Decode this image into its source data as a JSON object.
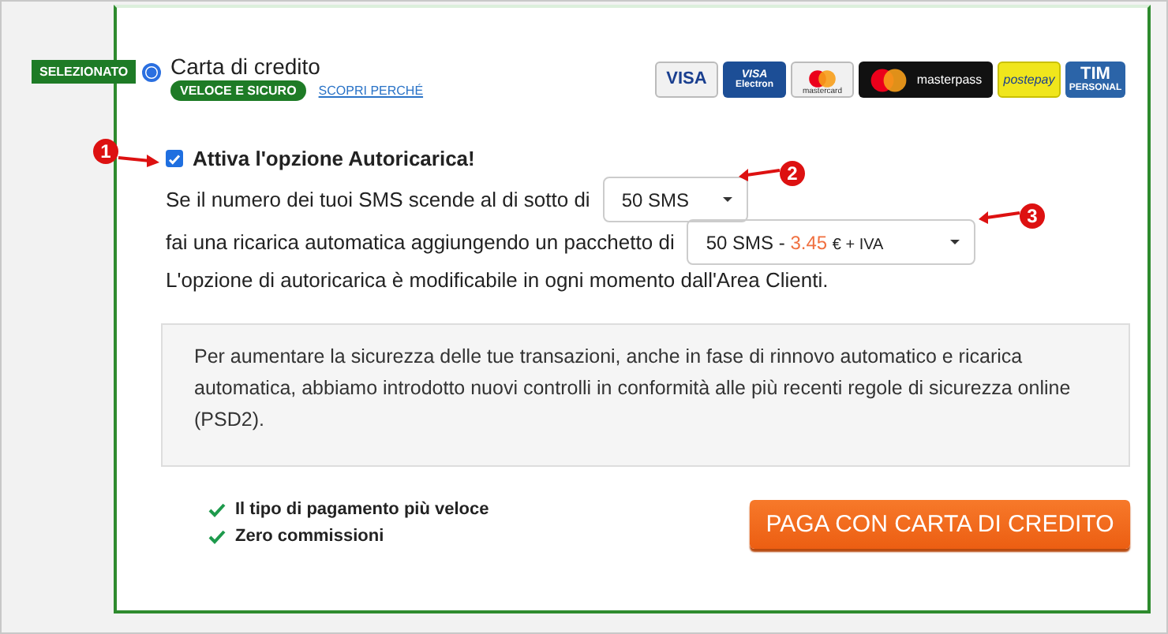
{
  "method": {
    "badge": "SELEZIONATO",
    "selected": true,
    "title": "Carta di credito",
    "tag": "VELOCE E SICURO",
    "link": "SCOPRI PERCHÉ"
  },
  "cards": [
    {
      "kind": "visa",
      "label": "VISA"
    },
    {
      "kind": "electron",
      "label": "VISA",
      "sub": "Electron"
    },
    {
      "kind": "mastercard",
      "label": "mastercard"
    },
    {
      "kind": "masterpass",
      "label": "masterpass"
    },
    {
      "kind": "postepay",
      "label": "postepay"
    },
    {
      "kind": "tim",
      "label": "TIM",
      "sub": "PERSONAL"
    }
  ],
  "autorecharge": {
    "label": "Attiva l'opzione Autoricarica!",
    "checked": true,
    "callout": "1"
  },
  "threshold": {
    "text": "Se il numero dei tuoi SMS scende al di sotto di",
    "value": "50 SMS",
    "callout": "2"
  },
  "package": {
    "text": "fai una ricarica automatica aggiungendo un pacchetto di",
    "value": "50 SMS -",
    "price": "3.45",
    "suffix": "€ + IVA",
    "callout": "3"
  },
  "note": "L'opzione di autoricarica è modificabile in ogni momento dall'Area Clienti.",
  "info": "Per aumentare la sicurezza delle tue transazioni, anche in fase di rinnovo automatico e ricarica automatica, abbiamo introdotto nuovi controlli in conformità alle più recenti regole di sicurezza online (PSD2).",
  "benefits": [
    "Il tipo di pagamento più veloce",
    "Zero commissioni"
  ],
  "pay_button": "PAGA CON CARTA DI CREDITO"
}
